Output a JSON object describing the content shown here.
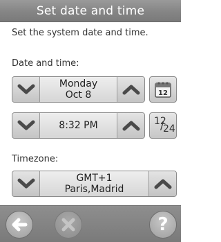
{
  "header": {
    "title": "Set date and time"
  },
  "description": "Set the system date and time.",
  "date_time": {
    "label": "Date and time:",
    "date": {
      "weekday": "Monday",
      "day": "Oct 8"
    },
    "time": "8:32 PM",
    "calendar_icon_day": "12",
    "format_toggle": {
      "top": "12",
      "bottom": "24"
    }
  },
  "timezone": {
    "label": "Timezone:",
    "offset": "GMT+1",
    "cities": "Paris,Madrid"
  },
  "footer": {
    "help_glyph": "?"
  },
  "icons": [
    "chevron-down-icon",
    "chevron-up-icon",
    "calendar-icon",
    "time-format-icon",
    "back-arrow-icon",
    "close-icon",
    "help-icon"
  ]
}
